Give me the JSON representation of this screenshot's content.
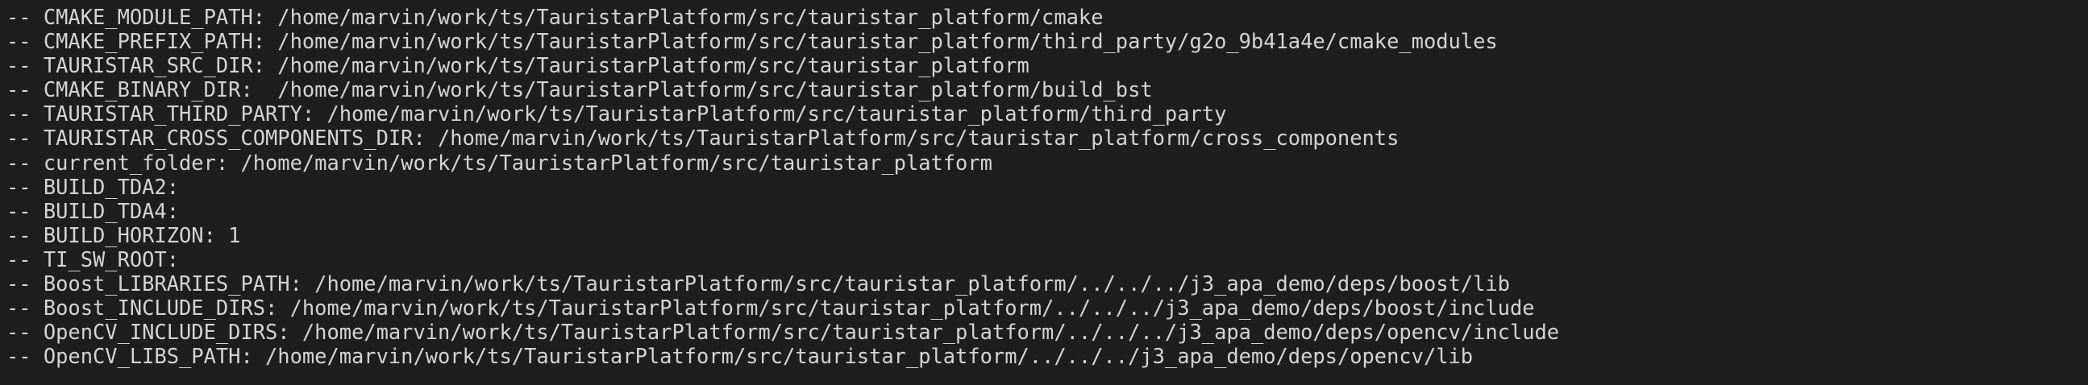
{
  "terminal": {
    "lines": [
      "-- CMAKE_MODULE_PATH: /home/marvin/work/ts/TauristarPlatform/src/tauristar_platform/cmake",
      "-- CMAKE_PREFIX_PATH: /home/marvin/work/ts/TauristarPlatform/src/tauristar_platform/third_party/g2o_9b41a4e/cmake_modules",
      "-- TAURISTAR_SRC_DIR: /home/marvin/work/ts/TauristarPlatform/src/tauristar_platform",
      "-- CMAKE_BINARY_DIR:  /home/marvin/work/ts/TauristarPlatform/src/tauristar_platform/build_bst",
      "-- TAURISTAR_THIRD_PARTY: /home/marvin/work/ts/TauristarPlatform/src/tauristar_platform/third_party",
      "-- TAURISTAR_CROSS_COMPONENTS_DIR: /home/marvin/work/ts/TauristarPlatform/src/tauristar_platform/cross_components",
      "-- current_folder: /home/marvin/work/ts/TauristarPlatform/src/tauristar_platform",
      "-- BUILD_TDA2:",
      "-- BUILD_TDA4:",
      "-- BUILD_HORIZON: 1",
      "-- TI_SW_ROOT:",
      "-- Boost_LIBRARIES_PATH: /home/marvin/work/ts/TauristarPlatform/src/tauristar_platform/../../../j3_apa_demo/deps/boost/lib",
      "-- Boost_INCLUDE_DIRS: /home/marvin/work/ts/TauristarPlatform/src/tauristar_platform/../../../j3_apa_demo/deps/boost/include",
      "-- OpenCV_INCLUDE_DIRS: /home/marvin/work/ts/TauristarPlatform/src/tauristar_platform/../../../j3_apa_demo/deps/opencv/include",
      "-- OpenCV_LIBS_PATH: /home/marvin/work/ts/TauristarPlatform/src/tauristar_platform/../../../j3_apa_demo/deps/opencv/lib"
    ]
  }
}
